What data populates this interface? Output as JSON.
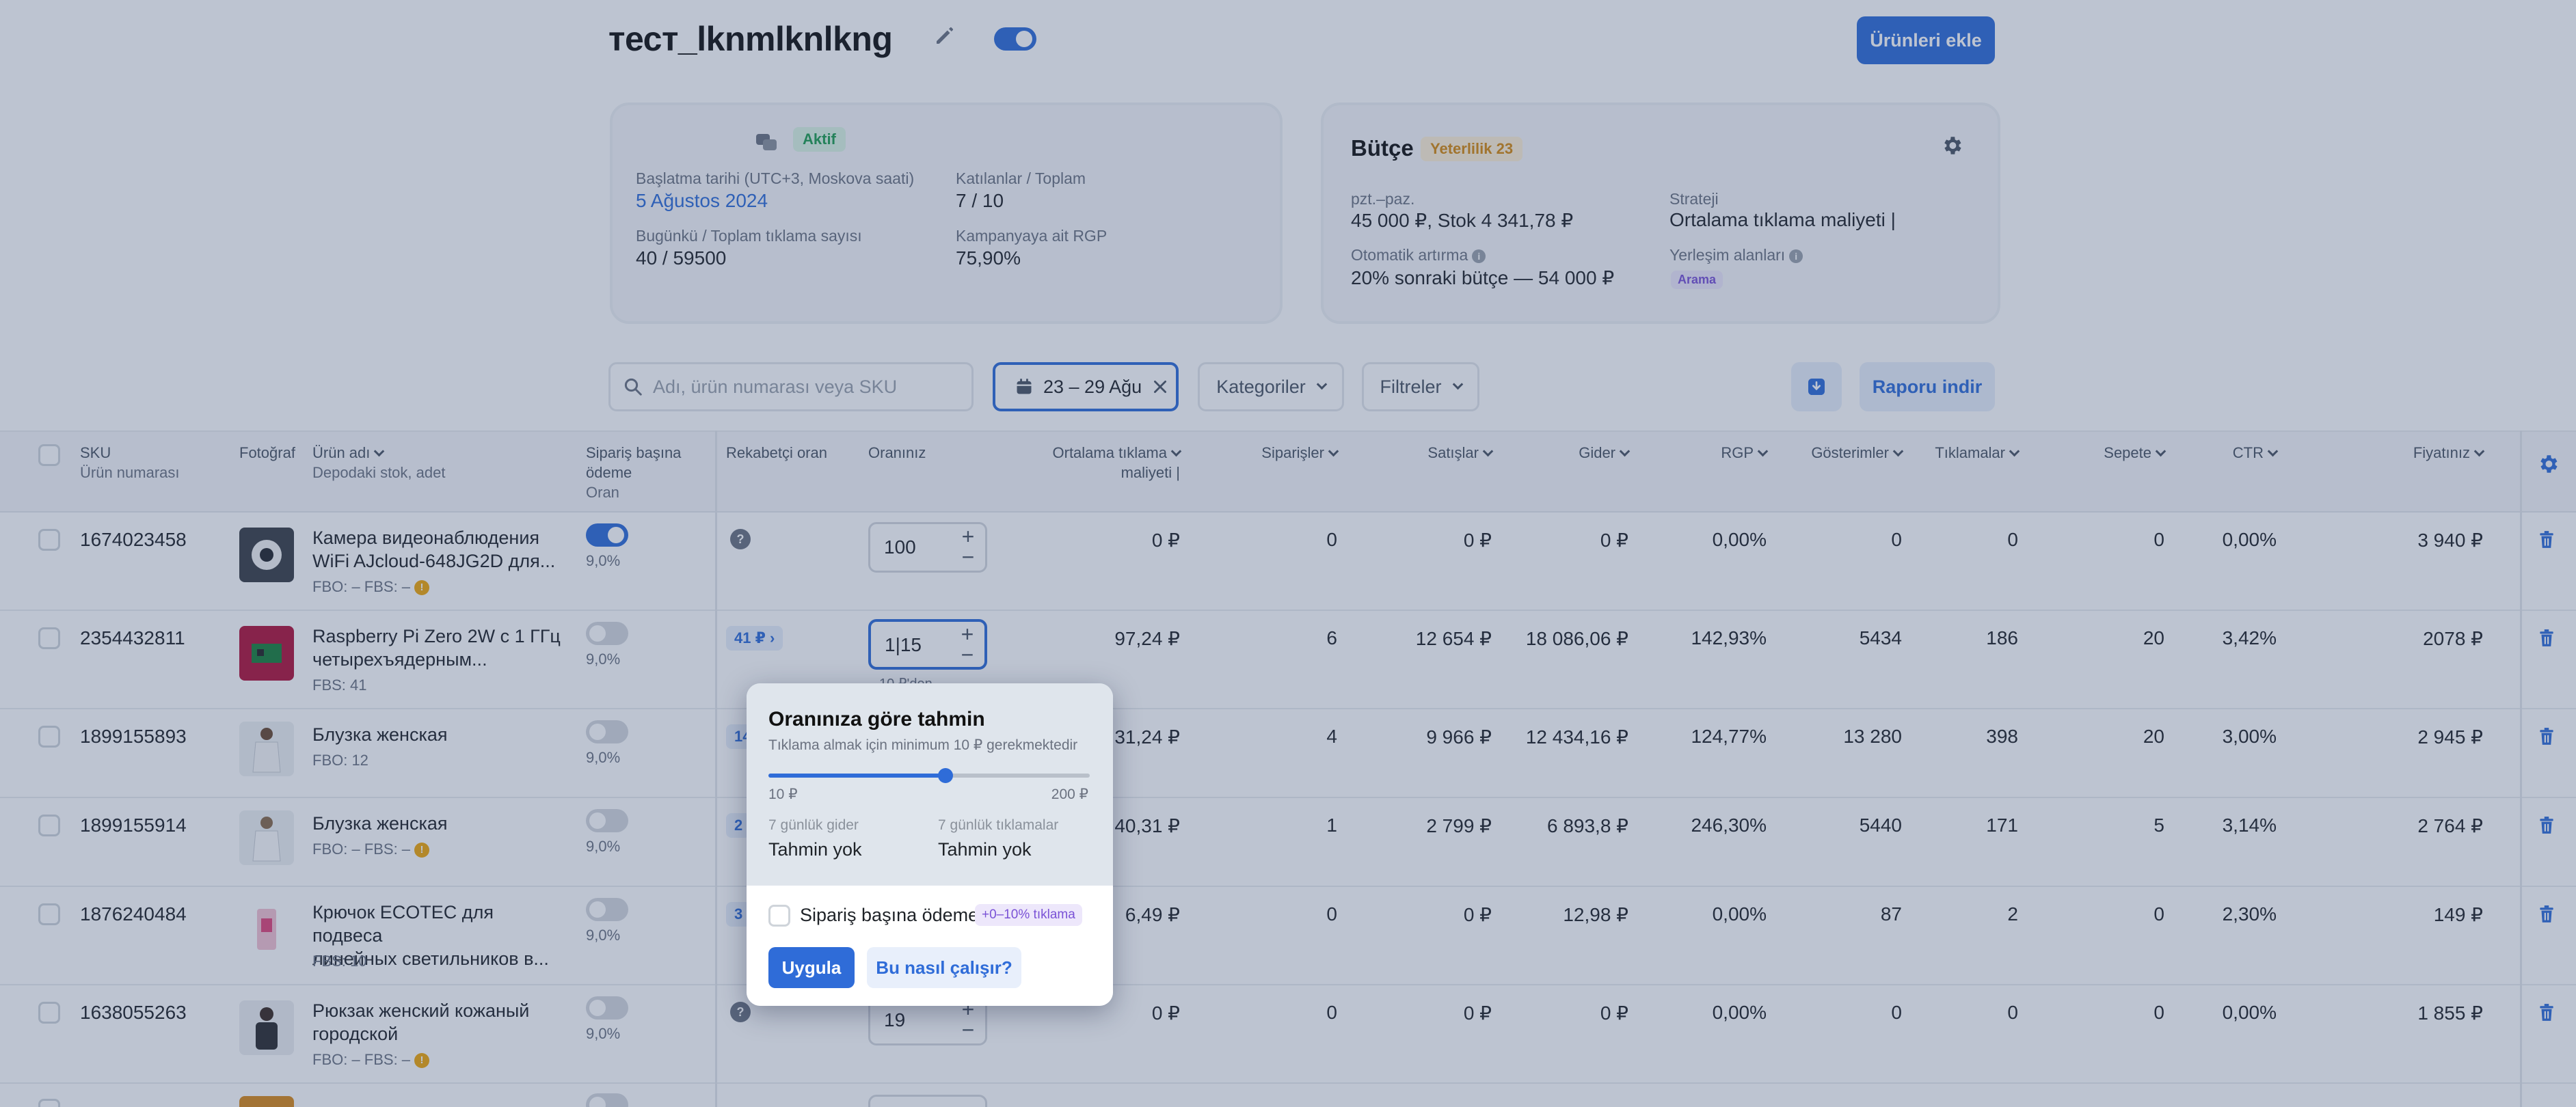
{
  "header": {
    "campaign_title": "тест_lknmlknlkng",
    "add_products_button": "Ürünleri ekle"
  },
  "stats_card": {
    "status_badge": "Aktif",
    "start_date_label": "Başlatma tarihi (UTC+3, Moskova saati)",
    "start_date_value": "5 Ağustos 2024",
    "joined_label": "Katılanlar / Toplam",
    "joined_value": "7 / 10",
    "clicks_label": "Bugünkü / Toplam tıklama sayısı",
    "clicks_value": "40 / 59500",
    "rgp_label": "Kampanyaya ait RGP",
    "rgp_value": "75,90%"
  },
  "budget_card": {
    "title": "Bütçe",
    "badge": "Yeterlilik 23",
    "schedule_label": "pzt.–paz.",
    "schedule_value": "45 000 ₽, Stok 4 341,78 ₽",
    "strategy_label": "Strateji",
    "strategy_value": "Ortalama tıklama maliyeti |",
    "auto_label": "Otomatik artırma",
    "auto_value": "20% sonraki bütçe — 54 000 ₽",
    "placement_label": "Yerleşim alanları",
    "placement_badge": "Arama"
  },
  "filters": {
    "search_placeholder": "Adı, ürün numarası veya SKU",
    "date_range": "23 – 29 Ağu",
    "categories": "Kategoriler",
    "filters": "Filtreler",
    "report_button": "Raporu indir"
  },
  "table": {
    "headers": {
      "sku": "SKU",
      "sku_sub": "Ürün numarası",
      "photo": "Fotoğraf",
      "name": "Ürün adı",
      "name_sub": "Depodaki stok, adet",
      "pay_per_order": "Sipariş başına",
      "pay_per_order_2": "ödeme",
      "pay_per_order_sub": "Oran",
      "competitor_rate": "Rekabetçi oran",
      "your_rate": "Oranınız",
      "avg_click_cost": "Ortalama tıklama",
      "avg_click_cost_2": "maliyeti |",
      "orders": "Siparişler",
      "sales": "Satışlar",
      "expense": "Gider",
      "rgp": "RGP",
      "impressions": "Gösterimler",
      "clicks": "Tıklamalar",
      "cart": "Sepete",
      "ctr": "CTR",
      "price": "Fiyatınız"
    },
    "rows": [
      {
        "sku": "1674023458",
        "name_1": "Камера видеонаблюдения",
        "name_2": "WiFi AJcloud-648JG2D для...",
        "stock": "FBO: –   FBS: –",
        "pct": "9,0%",
        "comp": "",
        "rate": "100",
        "avg": "0 ₽",
        "orders": "0",
        "sales": "0 ₽",
        "expense": "0 ₽",
        "rgp": "0,00%",
        "impr": "0",
        "clicks": "0",
        "cart": "0",
        "ctr": "0,00%",
        "price": "3 940 ₽"
      },
      {
        "sku": "2354432811",
        "name_1": "Raspberry Pi Zero 2W с 1 ГГц",
        "name_2": "четырехъядерным...",
        "stock": "FBS: 41",
        "pct": "9,0%",
        "comp": "41 ₽ ›",
        "rate": "1|15",
        "rate_hint": "10 ₽'den",
        "avg": "97,24 ₽",
        "orders": "6",
        "sales": "12 654 ₽",
        "expense": "18 086,06 ₽",
        "rgp": "142,93%",
        "impr": "5434",
        "clicks": "186",
        "cart": "20",
        "ctr": "3,42%",
        "price": "2078 ₽"
      },
      {
        "sku": "1899155893",
        "name_1": "Блузка женская",
        "name_2": "",
        "stock": "FBO: 12",
        "pct": "9,0%",
        "comp": "14",
        "rate": "",
        "avg": "31,24 ₽",
        "orders": "4",
        "sales": "9 966 ₽",
        "expense": "12 434,16 ₽",
        "rgp": "124,77%",
        "impr": "13 280",
        "clicks": "398",
        "cart": "20",
        "ctr": "3,00%",
        "price": "2 945 ₽"
      },
      {
        "sku": "1899155914",
        "name_1": "Блузка женская",
        "name_2": "",
        "stock": "FBO: –   FBS: –",
        "pct": "9,0%",
        "comp": "2",
        "rate": "",
        "avg": "40,31 ₽",
        "orders": "1",
        "sales": "2 799 ₽",
        "expense": "6 893,8 ₽",
        "rgp": "246,30%",
        "impr": "5440",
        "clicks": "171",
        "cart": "5",
        "ctr": "3,14%",
        "price": "2 764 ₽"
      },
      {
        "sku": "1876240484",
        "name_1": "Крючок ECOTEC для подвеса",
        "name_2": "линейных светильников в...",
        "stock": "FBS: 10",
        "pct": "9,0%",
        "comp": "3",
        "rate": "",
        "avg": "6,49 ₽",
        "orders": "0",
        "sales": "0 ₽",
        "expense": "12,98 ₽",
        "rgp": "0,00%",
        "impr": "87",
        "clicks": "2",
        "cart": "0",
        "ctr": "2,30%",
        "price": "149 ₽"
      },
      {
        "sku": "1638055263",
        "name_1": "Рюкзак женский кожаный",
        "name_2": "городской",
        "stock": "FBO: –   FBS: –",
        "pct": "9,0%",
        "comp": "",
        "rate": "19",
        "avg": "0 ₽",
        "orders": "0",
        "sales": "0 ₽",
        "expense": "0 ₽",
        "rgp": "0,00%",
        "impr": "0",
        "clicks": "0",
        "cart": "0",
        "ctr": "0,00%",
        "price": "1 855 ₽"
      }
    ]
  },
  "popover": {
    "title": "Oranınıza göre tahmin",
    "subtitle": "Tıklama almak için minimum 10 ₽ gerekmektedir",
    "slider_level_percent": 55,
    "range_min": "10 ₽",
    "range_max": "200 ₽",
    "expense_label": "7 günlük gider",
    "expense_value": "Tahmin yok",
    "clicks_label": "7 günlük tıklamalar",
    "clicks_value": "Tahmin yok",
    "checkbox_label": "Sipariş başına ödeme",
    "checkbox_badge": "+0–10% tıklama",
    "apply": "Uygula",
    "how": "Bu nasıl çalışır?"
  },
  "colors": {
    "accent": "#2f6cd8",
    "overlay": "rgba(50,73,112,0.32)"
  }
}
